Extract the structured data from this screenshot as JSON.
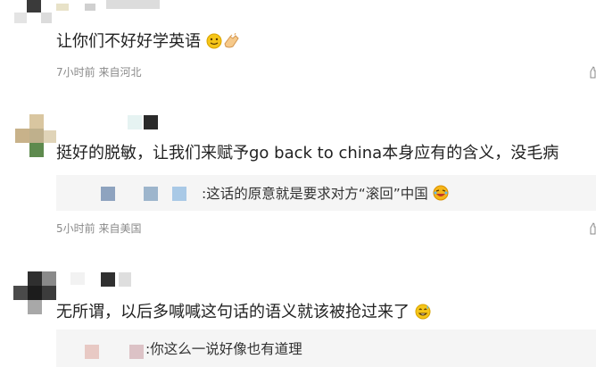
{
  "comments": [
    {
      "text": "让你们不好好学英语",
      "meta": "7小时前 来自河北",
      "emoji": [
        "smile-emoji",
        "clap-emoji"
      ]
    },
    {
      "text": "挺好的脱敏，让我们来赋予go back to china本身应有的含义，没毛病",
      "meta": "5小时前 来自美国",
      "reply": {
        "text": ":这话的原意就是要求对方“滚回”中国",
        "emoji": "laughing-emoji"
      }
    },
    {
      "text": "无所谓，以后多喊喊这句话的语义就该被抢过来了",
      "emoji": "sweat-smile-emoji",
      "reply": {
        "text": ":你这么一说好像也有道理"
      }
    }
  ],
  "colors": {
    "text": "#222222",
    "meta": "#8a8a8a",
    "reply_bg": "#f5f5f5"
  }
}
